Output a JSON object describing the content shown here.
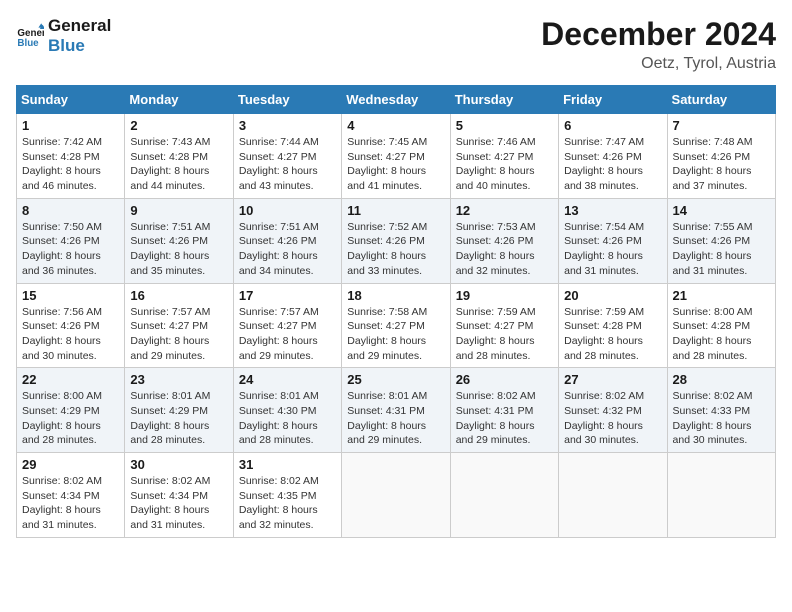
{
  "logo": {
    "line1": "General",
    "line2": "Blue"
  },
  "title": "December 2024",
  "location": "Oetz, Tyrol, Austria",
  "weekdays": [
    "Sunday",
    "Monday",
    "Tuesday",
    "Wednesday",
    "Thursday",
    "Friday",
    "Saturday"
  ],
  "weeks": [
    [
      {
        "day": "1",
        "sunrise": "7:42 AM",
        "sunset": "4:28 PM",
        "daylight": "8 hours and 46 minutes."
      },
      {
        "day": "2",
        "sunrise": "7:43 AM",
        "sunset": "4:28 PM",
        "daylight": "8 hours and 44 minutes."
      },
      {
        "day": "3",
        "sunrise": "7:44 AM",
        "sunset": "4:27 PM",
        "daylight": "8 hours and 43 minutes."
      },
      {
        "day": "4",
        "sunrise": "7:45 AM",
        "sunset": "4:27 PM",
        "daylight": "8 hours and 41 minutes."
      },
      {
        "day": "5",
        "sunrise": "7:46 AM",
        "sunset": "4:27 PM",
        "daylight": "8 hours and 40 minutes."
      },
      {
        "day": "6",
        "sunrise": "7:47 AM",
        "sunset": "4:26 PM",
        "daylight": "8 hours and 38 minutes."
      },
      {
        "day": "7",
        "sunrise": "7:48 AM",
        "sunset": "4:26 PM",
        "daylight": "8 hours and 37 minutes."
      }
    ],
    [
      {
        "day": "8",
        "sunrise": "7:50 AM",
        "sunset": "4:26 PM",
        "daylight": "8 hours and 36 minutes."
      },
      {
        "day": "9",
        "sunrise": "7:51 AM",
        "sunset": "4:26 PM",
        "daylight": "8 hours and 35 minutes."
      },
      {
        "day": "10",
        "sunrise": "7:51 AM",
        "sunset": "4:26 PM",
        "daylight": "8 hours and 34 minutes."
      },
      {
        "day": "11",
        "sunrise": "7:52 AM",
        "sunset": "4:26 PM",
        "daylight": "8 hours and 33 minutes."
      },
      {
        "day": "12",
        "sunrise": "7:53 AM",
        "sunset": "4:26 PM",
        "daylight": "8 hours and 32 minutes."
      },
      {
        "day": "13",
        "sunrise": "7:54 AM",
        "sunset": "4:26 PM",
        "daylight": "8 hours and 31 minutes."
      },
      {
        "day": "14",
        "sunrise": "7:55 AM",
        "sunset": "4:26 PM",
        "daylight": "8 hours and 31 minutes."
      }
    ],
    [
      {
        "day": "15",
        "sunrise": "7:56 AM",
        "sunset": "4:26 PM",
        "daylight": "8 hours and 30 minutes."
      },
      {
        "day": "16",
        "sunrise": "7:57 AM",
        "sunset": "4:27 PM",
        "daylight": "8 hours and 29 minutes."
      },
      {
        "day": "17",
        "sunrise": "7:57 AM",
        "sunset": "4:27 PM",
        "daylight": "8 hours and 29 minutes."
      },
      {
        "day": "18",
        "sunrise": "7:58 AM",
        "sunset": "4:27 PM",
        "daylight": "8 hours and 29 minutes."
      },
      {
        "day": "19",
        "sunrise": "7:59 AM",
        "sunset": "4:27 PM",
        "daylight": "8 hours and 28 minutes."
      },
      {
        "day": "20",
        "sunrise": "7:59 AM",
        "sunset": "4:28 PM",
        "daylight": "8 hours and 28 minutes."
      },
      {
        "day": "21",
        "sunrise": "8:00 AM",
        "sunset": "4:28 PM",
        "daylight": "8 hours and 28 minutes."
      }
    ],
    [
      {
        "day": "22",
        "sunrise": "8:00 AM",
        "sunset": "4:29 PM",
        "daylight": "8 hours and 28 minutes."
      },
      {
        "day": "23",
        "sunrise": "8:01 AM",
        "sunset": "4:29 PM",
        "daylight": "8 hours and 28 minutes."
      },
      {
        "day": "24",
        "sunrise": "8:01 AM",
        "sunset": "4:30 PM",
        "daylight": "8 hours and 28 minutes."
      },
      {
        "day": "25",
        "sunrise": "8:01 AM",
        "sunset": "4:31 PM",
        "daylight": "8 hours and 29 minutes."
      },
      {
        "day": "26",
        "sunrise": "8:02 AM",
        "sunset": "4:31 PM",
        "daylight": "8 hours and 29 minutes."
      },
      {
        "day": "27",
        "sunrise": "8:02 AM",
        "sunset": "4:32 PM",
        "daylight": "8 hours and 30 minutes."
      },
      {
        "day": "28",
        "sunrise": "8:02 AM",
        "sunset": "4:33 PM",
        "daylight": "8 hours and 30 minutes."
      }
    ],
    [
      {
        "day": "29",
        "sunrise": "8:02 AM",
        "sunset": "4:34 PM",
        "daylight": "8 hours and 31 minutes."
      },
      {
        "day": "30",
        "sunrise": "8:02 AM",
        "sunset": "4:34 PM",
        "daylight": "8 hours and 31 minutes."
      },
      {
        "day": "31",
        "sunrise": "8:02 AM",
        "sunset": "4:35 PM",
        "daylight": "8 hours and 32 minutes."
      },
      null,
      null,
      null,
      null
    ]
  ]
}
